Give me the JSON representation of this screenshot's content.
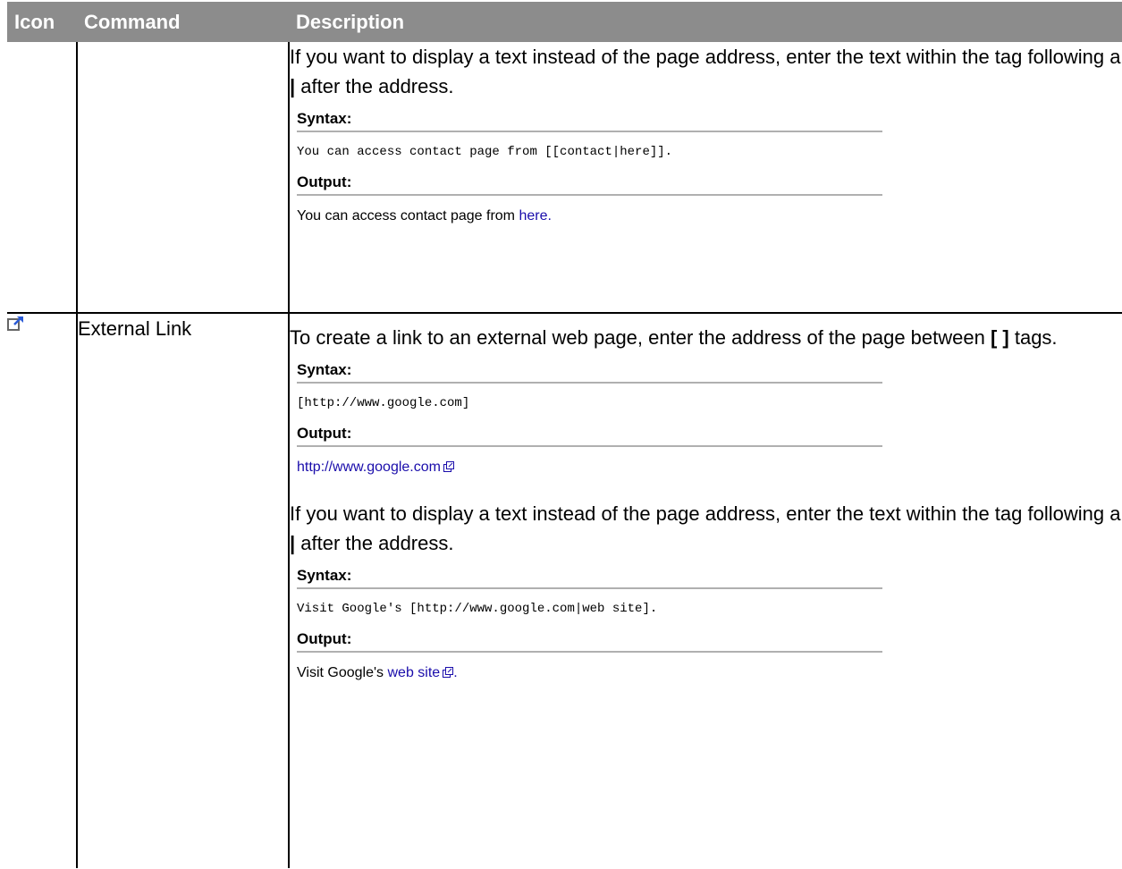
{
  "headers": {
    "icon": "Icon",
    "command": "Command",
    "description": "Description"
  },
  "row1": {
    "para": {
      "text1": "If you want to display a text instead of the page address, enter the text within the tag following a ",
      "bold": "|",
      "text2": " after the address."
    },
    "syntax_label": "Syntax:",
    "syntax_code": "You can access contact page from [[contact|here]].",
    "output_label": "Output:",
    "output_prefix": "You can access contact page from ",
    "output_link": "here",
    "output_suffix": "."
  },
  "row2": {
    "icon": "external-link-icon",
    "command": "External Link",
    "para1": {
      "text1": "To create a link to an external web page, enter the address of the page between ",
      "bold": "[ ]",
      "text2": " tags."
    },
    "syntax1_label": "Syntax:",
    "syntax1_code": "[http://www.google.com]",
    "output1_label": "Output:",
    "output1_link": "http://www.google.com",
    "para2": {
      "text1": "If you want to display a text instead of the page address, enter the text within the tag following a ",
      "bold": "|",
      "text2": " after the address."
    },
    "syntax2_label": "Syntax:",
    "syntax2_code": "Visit Google's [http://www.google.com|web site].",
    "output2_label": "Output:",
    "output2_prefix": "Visit Google's ",
    "output2_link": "web site",
    "output2_suffix": "."
  },
  "colors": {
    "header_bg": "#8c8c8c",
    "link": "#1a0dab",
    "rule": "#b0b0b0"
  }
}
